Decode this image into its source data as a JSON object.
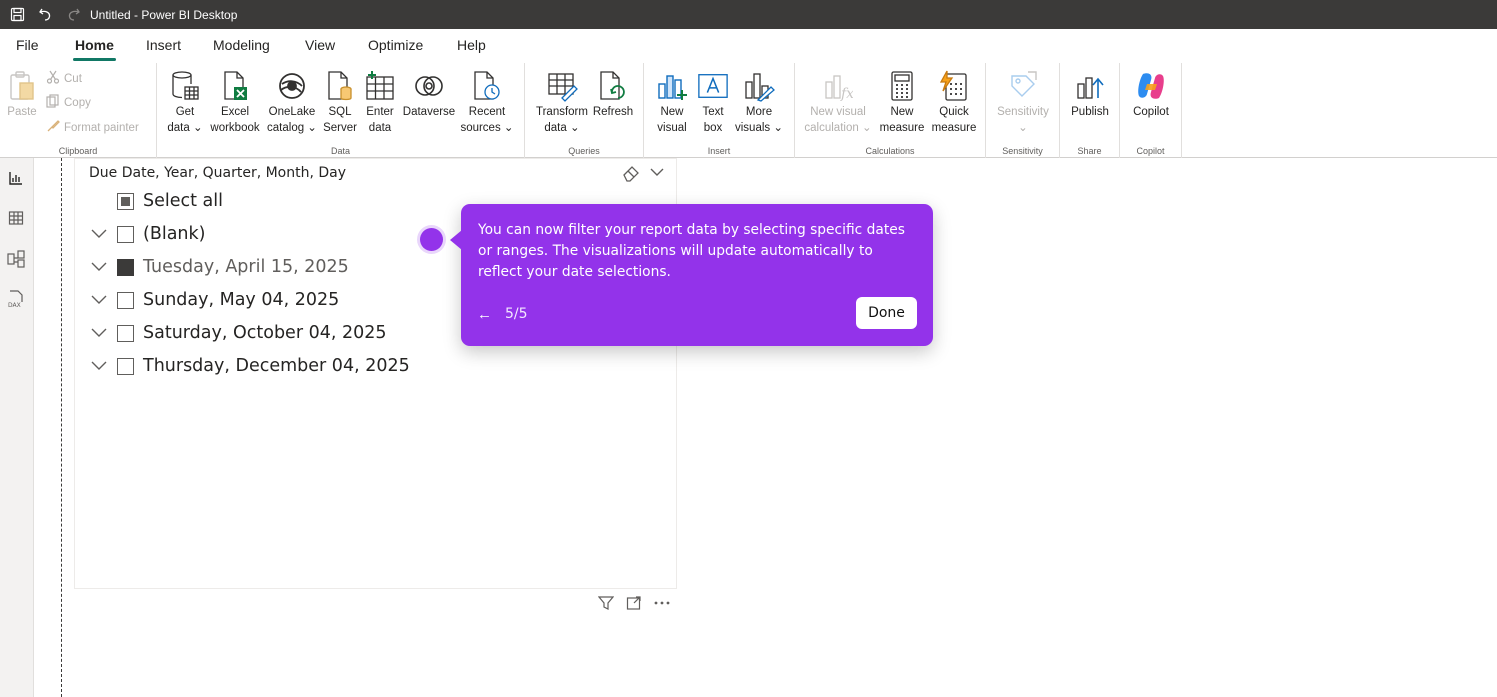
{
  "window": {
    "title": "Untitled - Power BI Desktop"
  },
  "menu": {
    "tabs": [
      "File",
      "Home",
      "Insert",
      "Modeling",
      "View",
      "Optimize",
      "Help"
    ],
    "active": "Home"
  },
  "ribbon": {
    "clipboard": {
      "label": "Clipboard",
      "paste": "Paste",
      "cut": "Cut",
      "copy": "Copy",
      "format_painter": "Format painter"
    },
    "data": {
      "label": "Data",
      "get_data": [
        "Get",
        "data ⌄"
      ],
      "excel": [
        "Excel",
        "workbook"
      ],
      "onelake": [
        "OneLake",
        "catalog ⌄"
      ],
      "sql": [
        "SQL",
        "Server"
      ],
      "enter": [
        "Enter",
        "data"
      ],
      "dataverse": [
        "Dataverse",
        ""
      ],
      "recent": [
        "Recent",
        "sources ⌄"
      ]
    },
    "queries": {
      "label": "Queries",
      "transform": [
        "Transform",
        "data ⌄"
      ],
      "refresh": [
        "Refresh",
        ""
      ]
    },
    "insert": {
      "label": "Insert",
      "new_visual": [
        "New",
        "visual"
      ],
      "text_box": [
        "Text",
        "box"
      ],
      "more_visuals": [
        "More",
        "visuals ⌄"
      ]
    },
    "calculations": {
      "label": "Calculations",
      "new_visual_calc": [
        "New visual",
        "calculation ⌄"
      ],
      "new_measure": [
        "New",
        "measure"
      ],
      "quick_measure": [
        "Quick",
        "measure"
      ]
    },
    "sensitivity": {
      "label": "Sensitivity",
      "button": [
        "Sensitivity",
        "⌄"
      ]
    },
    "share": {
      "label": "Share",
      "publish": [
        "Publish",
        ""
      ]
    },
    "copilot": {
      "label": "Copilot",
      "button": [
        "Copilot",
        ""
      ]
    }
  },
  "slicer": {
    "header": "Due Date, Year, Quarter, Month, Day",
    "select_all": "Select all",
    "items": [
      {
        "label": "(Blank)",
        "checked": false
      },
      {
        "label": "Tuesday, April 15, 2025",
        "checked": true
      },
      {
        "label": "Sunday, May 04, 2025",
        "checked": false
      },
      {
        "label": "Saturday, October 04, 2025",
        "checked": false
      },
      {
        "label": "Thursday, December 04, 2025",
        "checked": false
      }
    ]
  },
  "tour": {
    "message": "You can now filter your report data by selecting specific dates or ranges. The visualizations will update automatically to reflect your date selections.",
    "back": "←",
    "step": "5/5",
    "done": "Done",
    "color": "#9333ea"
  }
}
